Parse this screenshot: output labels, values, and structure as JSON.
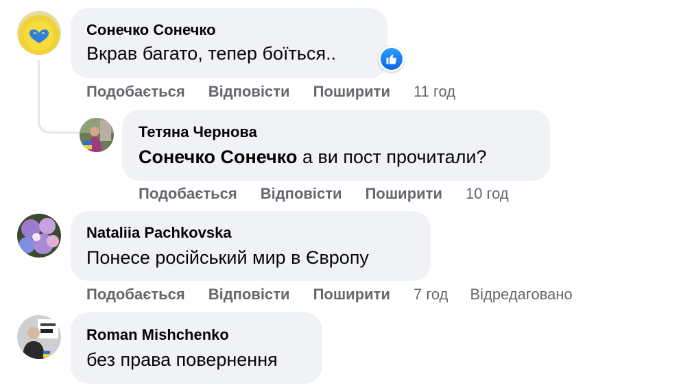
{
  "comments": [
    {
      "author": "Сонечко Сонечко",
      "text": "Вкрав багато, тепер боїться..",
      "actions": {
        "like": "Подобається",
        "reply": "Відповісти",
        "share": "Поширити",
        "time": "11 год"
      },
      "reaction": "like-icon"
    },
    {
      "author": "Тетяна Чернова",
      "mention": "Сонечко Сонечко",
      "text": " а ви пост прочитали?",
      "actions": {
        "like": "Подобається",
        "reply": "Відповісти",
        "share": "Поширити",
        "time": "10 год"
      }
    },
    {
      "author": "Nataliia Pachkovska",
      "text": "Понесе російський мир в Європу",
      "actions": {
        "like": "Подобається",
        "reply": "Відповісти",
        "share": "Поширити",
        "time": "7 год",
        "edited": "Відредаговано"
      }
    },
    {
      "author": "Roman Mishchenko",
      "text": "без права повернення"
    }
  ],
  "colors": {
    "bubble": "#f0f2f5",
    "meta": "#65676b",
    "like_blue": "#1877f2"
  }
}
